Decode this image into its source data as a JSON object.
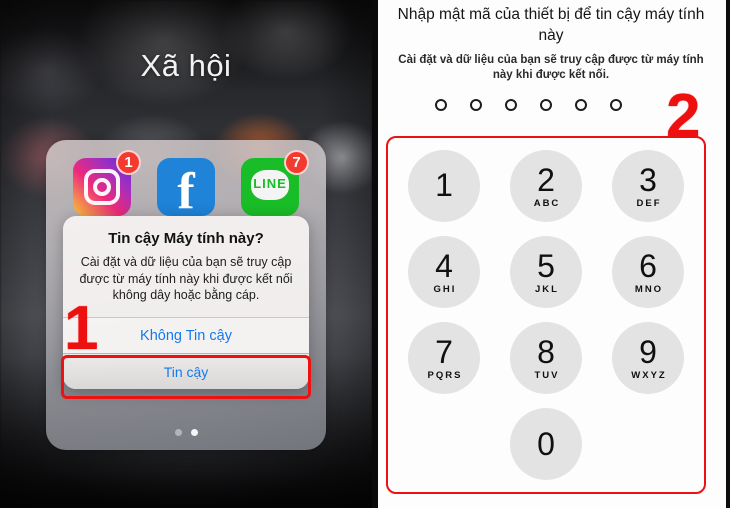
{
  "left_panel": {
    "folder_title": "Xã hội",
    "apps": [
      {
        "name": "Instagram",
        "icon": "instagram-icon",
        "badge": "1"
      },
      {
        "name": "Facebook",
        "icon": "facebook-icon",
        "badge": ""
      },
      {
        "name": "LINE",
        "icon": "line-icon",
        "badge": "7",
        "glyph": "LINE"
      }
    ],
    "page_dots": {
      "count": 2,
      "active_index": 1
    },
    "dialog": {
      "title": "Tin cậy Máy tính này?",
      "body": "Cài đặt và dữ liệu của bạn sẽ truy cập được từ máy tính này khi được kết nối không dây hoặc bằng cáp.",
      "deny_label": "Không Tin cậy",
      "trust_label": "Tin cậy"
    }
  },
  "right_panel": {
    "title": "Nhập mật mã của thiết bị để tin cậy máy tính này",
    "subtitle": "Cài đặt và dữ liệu của bạn sẽ truy cập được từ máy tính này khi được kết nối.",
    "passcode_dots": {
      "count": 6,
      "filled": 0
    },
    "keypad": [
      {
        "digit": "1",
        "letters": ""
      },
      {
        "digit": "2",
        "letters": "ABC"
      },
      {
        "digit": "3",
        "letters": "DEF"
      },
      {
        "digit": "4",
        "letters": "GHI"
      },
      {
        "digit": "5",
        "letters": "JKL"
      },
      {
        "digit": "6",
        "letters": "MNO"
      },
      {
        "digit": "7",
        "letters": "PQRS"
      },
      {
        "digit": "8",
        "letters": "TUV"
      },
      {
        "digit": "9",
        "letters": "WXYZ"
      },
      {
        "digit": "0",
        "letters": ""
      }
    ]
  },
  "annotations": {
    "step_one": "1",
    "step_two": "2"
  },
  "colors": {
    "accent_red": "#ee1111",
    "ios_blue": "#1479f0",
    "badge_red": "#f23a2e",
    "key_gray": "#e3e3e3"
  }
}
